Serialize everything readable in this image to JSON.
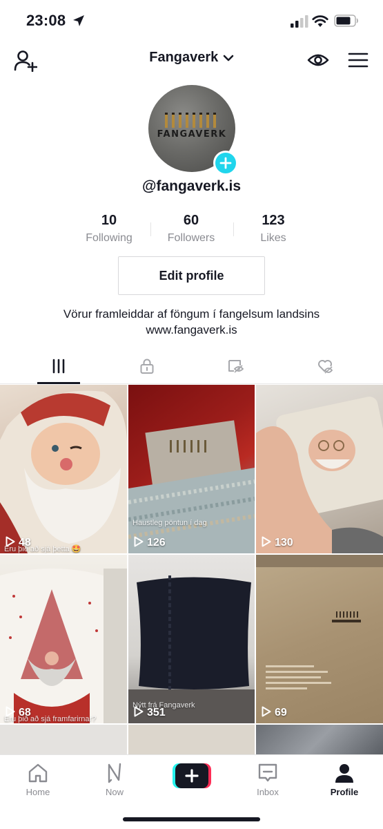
{
  "status_bar": {
    "time": "23:08"
  },
  "header": {
    "title": "Fangaverk"
  },
  "profile": {
    "avatar_text": "FANGAVERK",
    "username": "@fangaverk.is",
    "stats": [
      {
        "value": "10",
        "label": "Following"
      },
      {
        "value": "60",
        "label": "Followers"
      },
      {
        "value": "123",
        "label": "Likes"
      }
    ],
    "edit_button": "Edit profile",
    "bio_line1": "Vörur framleiddar af föngum í fangelsum landsins",
    "bio_line2": "www.fangaverk.is"
  },
  "tabs": [
    {
      "icon": "grid-icon",
      "active": true
    },
    {
      "icon": "lock-icon",
      "active": false
    },
    {
      "icon": "tagged-icon",
      "active": false
    },
    {
      "icon": "liked-icon",
      "active": false
    }
  ],
  "videos": [
    {
      "views": "48",
      "caption": "Eru þið að sjá þetta 🤩",
      "theme": "santa-mug"
    },
    {
      "views": "126",
      "caption": "Haustleg pöntun í dag",
      "theme": "knit-box"
    },
    {
      "views": "130",
      "caption": "",
      "theme": "santa-hand"
    },
    {
      "views": "68",
      "caption": "Eru þið að sjá framfarirnar?",
      "theme": "gnome-mug"
    },
    {
      "views": "351",
      "caption": "Nýtt frá Fangaverk",
      "theme": "pillow"
    },
    {
      "views": "69",
      "caption": "",
      "theme": "box-lid"
    }
  ],
  "bottom_nav": [
    {
      "label": "Home",
      "icon": "home-icon",
      "active": false
    },
    {
      "label": "Now",
      "icon": "now-icon",
      "active": false
    },
    {
      "label": "",
      "icon": "create-icon",
      "active": false
    },
    {
      "label": "Inbox",
      "icon": "inbox-icon",
      "active": false
    },
    {
      "label": "Profile",
      "icon": "profile-icon",
      "active": true
    }
  ]
}
